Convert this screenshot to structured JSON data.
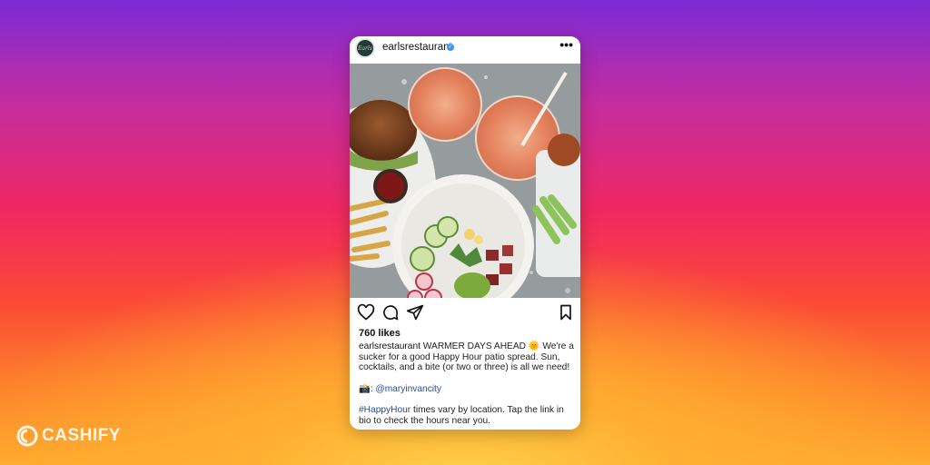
{
  "post": {
    "avatar_text": "Earls",
    "username": "earlsrestaurant",
    "verified_mark": "✓",
    "more_label": "•••",
    "likes": "760 likes",
    "caption": {
      "user": "earlsrestaurant",
      "line1_rest": " WARMER DAYS AHEAD 🌞  We're a sucker for a good Happy Hour patio spread. Sun, cocktails, and a bite (or two or three) is all we need!",
      "credit_icon": "📸",
      "credit_sep": ": ",
      "credit_handle": "@maryinvancity",
      "hashtag": "#HappyHour",
      "line3_rest": " times vary by location. Tap the link in bio to check the hours near you."
    }
  },
  "icons": {
    "like": "heart-icon",
    "comment": "comment-icon",
    "share": "send-icon",
    "save": "bookmark-icon"
  },
  "brand": {
    "name": "CASHIFY"
  },
  "colors": {
    "verified": "#3897f0",
    "link": "#2b4d8c"
  }
}
